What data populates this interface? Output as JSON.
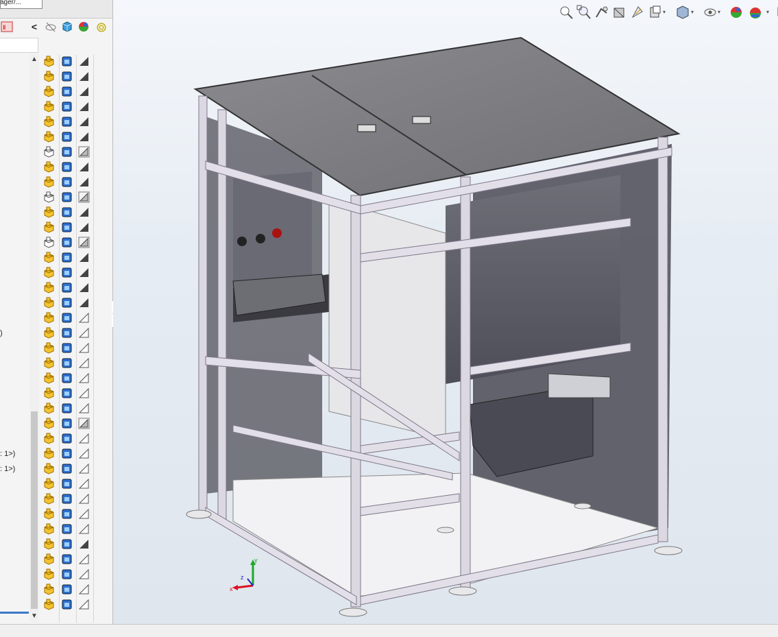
{
  "window": {
    "tab_fragment": "ager/..."
  },
  "panel_toolbar": {
    "icons": [
      "back-chevron-icon",
      "hide-show-icon",
      "appearance-cube-icon",
      "scene-sphere-icon",
      "display-pane-icon"
    ],
    "back_glyph": "<"
  },
  "tree": {
    "cut_labels": [
      ")",
      ": 1>)",
      ": 1>)"
    ],
    "rows": [
      {
        "type": "part",
        "state": "resolved",
        "sketch": "solid"
      },
      {
        "type": "part",
        "state": "resolved",
        "sketch": "solid"
      },
      {
        "type": "part",
        "state": "resolved",
        "sketch": "solid"
      },
      {
        "type": "part",
        "state": "resolved",
        "sketch": "solid"
      },
      {
        "type": "part",
        "state": "resolved",
        "sketch": "solid"
      },
      {
        "type": "part",
        "state": "resolved",
        "sketch": "solid"
      },
      {
        "type": "part",
        "state": "lightweight",
        "sketch": "hatched"
      },
      {
        "type": "part",
        "state": "resolved",
        "sketch": "solid"
      },
      {
        "type": "part",
        "state": "resolved",
        "sketch": "solid"
      },
      {
        "type": "part",
        "state": "lightweight",
        "sketch": "hatched"
      },
      {
        "type": "part",
        "state": "resolved",
        "sketch": "solid"
      },
      {
        "type": "part",
        "state": "resolved",
        "sketch": "solid"
      },
      {
        "type": "part",
        "state": "lightweight",
        "sketch": "hatched"
      },
      {
        "type": "part",
        "state": "resolved",
        "sketch": "solid"
      },
      {
        "type": "part",
        "state": "resolved",
        "sketch": "solid"
      },
      {
        "type": "part",
        "state": "resolved",
        "sketch": "solid"
      },
      {
        "type": "part",
        "state": "resolved",
        "sketch": "solid"
      },
      {
        "type": "part",
        "state": "resolved",
        "sketch": "outline"
      },
      {
        "type": "part",
        "state": "resolved",
        "sketch": "outline"
      },
      {
        "type": "part",
        "state": "resolved",
        "sketch": "outline"
      },
      {
        "type": "part",
        "state": "resolved",
        "sketch": "outline"
      },
      {
        "type": "part",
        "state": "resolved",
        "sketch": "outline"
      },
      {
        "type": "part",
        "state": "resolved",
        "sketch": "outline"
      },
      {
        "type": "part",
        "state": "resolved",
        "sketch": "outline"
      },
      {
        "type": "part",
        "state": "resolved",
        "sketch": "hatched"
      },
      {
        "type": "part",
        "state": "resolved",
        "sketch": "outline"
      },
      {
        "type": "part",
        "state": "resolved",
        "sketch": "outline"
      },
      {
        "type": "part",
        "state": "resolved",
        "sketch": "outline"
      },
      {
        "type": "part",
        "state": "resolved",
        "sketch": "outline"
      },
      {
        "type": "part",
        "state": "resolved",
        "sketch": "outline"
      },
      {
        "type": "part",
        "state": "resolved",
        "sketch": "outline"
      },
      {
        "type": "part",
        "state": "resolved",
        "sketch": "outline"
      },
      {
        "type": "part",
        "state": "resolved",
        "sketch": "solid"
      },
      {
        "type": "part",
        "state": "resolved",
        "sketch": "outline"
      },
      {
        "type": "part",
        "state": "resolved",
        "sketch": "outline"
      },
      {
        "type": "part",
        "state": "resolved",
        "sketch": "outline"
      },
      {
        "type": "part",
        "state": "resolved",
        "sketch": "outline"
      }
    ]
  },
  "heads_up_toolbar": {
    "icons": [
      "zoom-to-fit-icon",
      "zoom-to-area-icon",
      "previous-view-icon",
      "section-view-icon",
      "dynamic-annotation-icon",
      "view-orientation-icon",
      "display-style-icon",
      "hide-show-items-icon",
      "edit-appearance-icon",
      "apply-scene-icon",
      "view-settings-icon"
    ]
  },
  "triad": {
    "x_label": "x",
    "y_label": "y",
    "z_label": "z"
  },
  "colors": {
    "accent": "#3c78c8",
    "part_yellow": "#f4c430",
    "model_frame": "#d9d6df",
    "model_panel": "#7d7d82"
  }
}
